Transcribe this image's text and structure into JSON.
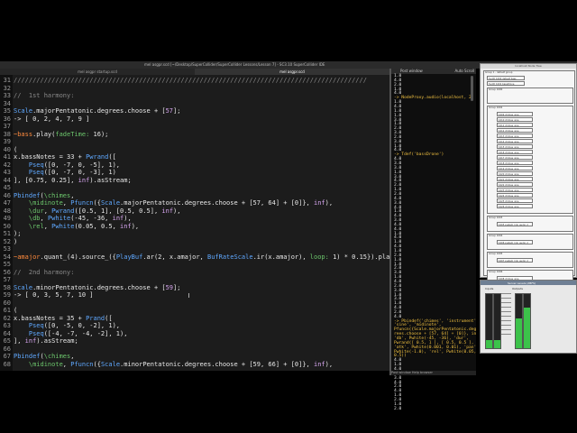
{
  "window": {
    "title": "mel asgpr.scd  [~/Desktop/SuperCollider/SuperCollider Lessons/Lesson 7] - SC3.10  SuperCollider IDE",
    "traffic": [
      "#ff5f56",
      "#ffbd2e",
      "#27c93f"
    ]
  },
  "tabs": [
    {
      "label": "mel asgpr startup.scd"
    },
    {
      "label": "mel asgpr.scd"
    }
  ],
  "editor": {
    "lines": [
      {
        "n": "31",
        "tokens": [
          {
            "c": "t-cmt",
            "t": "/////////////////////////////////////////////////////////////////////////////////////////////"
          }
        ]
      },
      {
        "n": "32",
        "tokens": []
      },
      {
        "n": "33",
        "tokens": [
          {
            "c": "t-cmt",
            "t": "//  1st harmony:"
          }
        ]
      },
      {
        "n": "34",
        "tokens": []
      },
      {
        "n": "35",
        "tokens": [
          {
            "c": "t-cls",
            "t": "Scale"
          },
          {
            "c": "t-def",
            "t": ".majorPentatonic.degrees.choose + ["
          },
          {
            "c": "t-num",
            "t": "57"
          },
          {
            "c": "t-def",
            "t": "];"
          }
        ]
      },
      {
        "n": "36",
        "tokens": [
          {
            "c": "t-def",
            "t": "-> [ 0, 2, 4, 7, 9 ]"
          }
        ]
      },
      {
        "n": "37",
        "tokens": []
      },
      {
        "n": "38",
        "tokens": [
          {
            "c": "t-env",
            "t": "~bass"
          },
          {
            "c": "t-def",
            "t": ".play("
          },
          {
            "c": "t-sym",
            "t": "fadeTime:"
          },
          {
            "c": "t-def",
            "t": " 16);"
          }
        ]
      },
      {
        "n": "39",
        "tokens": []
      },
      {
        "n": "40",
        "tokens": [
          {
            "c": "t-def",
            "t": "("
          }
        ]
      },
      {
        "n": "41",
        "tokens": [
          {
            "c": "t-def",
            "t": "x.bassNotes = 33 + "
          },
          {
            "c": "t-cls",
            "t": "Pwrand"
          },
          {
            "c": "t-def",
            "t": "(["
          }
        ]
      },
      {
        "n": "42",
        "tokens": [
          {
            "c": "t-def",
            "t": "    "
          },
          {
            "c": "t-cls",
            "t": "Pseq"
          },
          {
            "c": "t-def",
            "t": "([0, -7, 0, -5], 1),"
          }
        ]
      },
      {
        "n": "43",
        "tokens": [
          {
            "c": "t-def",
            "t": "    "
          },
          {
            "c": "t-cls",
            "t": "Pseq"
          },
          {
            "c": "t-def",
            "t": "([0, -7, 0, -3], 1)"
          }
        ]
      },
      {
        "n": "44",
        "tokens": [
          {
            "c": "t-def",
            "t": "], [0.75, 0.25], "
          },
          {
            "c": "t-num",
            "t": "inf"
          },
          {
            "c": "t-def",
            "t": ").asStream;"
          }
        ]
      },
      {
        "n": "45",
        "tokens": []
      },
      {
        "n": "46",
        "tokens": [
          {
            "c": "t-cls",
            "t": "Pbindef"
          },
          {
            "c": "t-def",
            "t": "("
          },
          {
            "c": "t-sym",
            "t": "\\chimes"
          },
          {
            "c": "t-def",
            "t": ","
          }
        ]
      },
      {
        "n": "47",
        "tokens": [
          {
            "c": "t-def",
            "t": "    "
          },
          {
            "c": "t-sym",
            "t": "\\midinote"
          },
          {
            "c": "t-def",
            "t": ", "
          },
          {
            "c": "t-cls",
            "t": "Pfuncn"
          },
          {
            "c": "t-def",
            "t": "({"
          },
          {
            "c": "t-cls",
            "t": "Scale"
          },
          {
            "c": "t-def",
            "t": ".majorPentatonic.degrees.choose + [57, 64] + [0]}, "
          },
          {
            "c": "t-num",
            "t": "inf"
          },
          {
            "c": "t-def",
            "t": "),"
          }
        ]
      },
      {
        "n": "48",
        "tokens": [
          {
            "c": "t-def",
            "t": "    "
          },
          {
            "c": "t-sym",
            "t": "\\dur"
          },
          {
            "c": "t-def",
            "t": ", "
          },
          {
            "c": "t-cls",
            "t": "Pwrand"
          },
          {
            "c": "t-def",
            "t": "([0.5, 1], [0.5, 0.5], "
          },
          {
            "c": "t-num",
            "t": "inf"
          },
          {
            "c": "t-def",
            "t": "),"
          }
        ]
      },
      {
        "n": "49",
        "tokens": [
          {
            "c": "t-def",
            "t": "    "
          },
          {
            "c": "t-sym",
            "t": "\\db"
          },
          {
            "c": "t-def",
            "t": ", "
          },
          {
            "c": "t-cls",
            "t": "Pwhite"
          },
          {
            "c": "t-def",
            "t": "(-45, -36, "
          },
          {
            "c": "t-num",
            "t": "inf"
          },
          {
            "c": "t-def",
            "t": "),"
          }
        ]
      },
      {
        "n": "50",
        "tokens": [
          {
            "c": "t-def",
            "t": "    "
          },
          {
            "c": "t-sym",
            "t": "\\rel"
          },
          {
            "c": "t-def",
            "t": ", "
          },
          {
            "c": "t-cls",
            "t": "Pwhite"
          },
          {
            "c": "t-def",
            "t": "(0.05, 0.5, "
          },
          {
            "c": "t-num",
            "t": "inf"
          },
          {
            "c": "t-def",
            "t": "),"
          }
        ]
      },
      {
        "n": "51",
        "tokens": [
          {
            "c": "t-def",
            "t": ");"
          }
        ]
      },
      {
        "n": "52",
        "tokens": [
          {
            "c": "t-def",
            "t": ")"
          }
        ]
      },
      {
        "n": "53",
        "tokens": []
      },
      {
        "n": "54",
        "tokens": [
          {
            "c": "t-env",
            "t": "~amajor"
          },
          {
            "c": "t-def",
            "t": ".quant_(4).source_({"
          },
          {
            "c": "t-cls",
            "t": "PlayBuf"
          },
          {
            "c": "t-def",
            "t": ".ar(2, x.amajor, "
          },
          {
            "c": "t-cls",
            "t": "BufRateScale"
          },
          {
            "c": "t-def",
            "t": ".ir(x.amajor), "
          },
          {
            "c": "t-sym",
            "t": "loop:"
          },
          {
            "c": "t-def",
            "t": " 1) * 0.15}).play("
          },
          {
            "c": "t-sym",
            "t": "fadeTime:"
          },
          {
            "c": "t-def",
            "t": " 16);"
          }
        ]
      },
      {
        "n": "55",
        "tokens": []
      },
      {
        "n": "56",
        "tokens": [
          {
            "c": "t-cmt",
            "t": "//  2nd harmony:"
          }
        ]
      },
      {
        "n": "57",
        "tokens": []
      },
      {
        "n": "58",
        "tokens": [
          {
            "c": "t-cls",
            "t": "Scale"
          },
          {
            "c": "t-def",
            "t": ".minorPentatonic.degrees.choose + ["
          },
          {
            "c": "t-num",
            "t": "59"
          },
          {
            "c": "t-def",
            "t": "];"
          }
        ]
      },
      {
        "n": "59",
        "tokens": [
          {
            "c": "t-def",
            "t": "-> [ 0, 3, 5, 7, 10 ]"
          }
        ]
      },
      {
        "n": "60",
        "tokens": []
      },
      {
        "n": "61",
        "tokens": [
          {
            "c": "t-def",
            "t": "("
          }
        ]
      },
      {
        "n": "62",
        "tokens": [
          {
            "c": "t-def",
            "t": "x.bassNotes = 35 + "
          },
          {
            "c": "t-cls",
            "t": "Prand"
          },
          {
            "c": "t-def",
            "t": "(["
          }
        ]
      },
      {
        "n": "63",
        "tokens": [
          {
            "c": "t-def",
            "t": "    "
          },
          {
            "c": "t-cls",
            "t": "Pseq"
          },
          {
            "c": "t-def",
            "t": "([0, -5, 0, -2], 1),"
          }
        ]
      },
      {
        "n": "64",
        "tokens": [
          {
            "c": "t-def",
            "t": "    "
          },
          {
            "c": "t-cls",
            "t": "Pseq"
          },
          {
            "c": "t-def",
            "t": "([-4, -7, -4, -2], 1),"
          }
        ]
      },
      {
        "n": "65",
        "tokens": [
          {
            "c": "t-def",
            "t": "], "
          },
          {
            "c": "t-num",
            "t": "inf"
          },
          {
            "c": "t-def",
            "t": ").asStream;"
          }
        ]
      },
      {
        "n": "66",
        "tokens": []
      },
      {
        "n": "67",
        "tokens": [
          {
            "c": "t-cls",
            "t": "Pbindef"
          },
          {
            "c": "t-def",
            "t": "("
          },
          {
            "c": "t-sym",
            "t": "\\chimes"
          },
          {
            "c": "t-def",
            "t": ","
          }
        ]
      },
      {
        "n": "68",
        "tokens": [
          {
            "c": "t-def",
            "t": "    "
          },
          {
            "c": "t-sym",
            "t": "\\midinote"
          },
          {
            "c": "t-def",
            "t": ", "
          },
          {
            "c": "t-cls",
            "t": "Pfuncn"
          },
          {
            "c": "t-def",
            "t": "({"
          },
          {
            "c": "t-cls",
            "t": "Scale"
          },
          {
            "c": "t-def",
            "t": ".minorPentatonic.degrees.choose + [59, 66] + [0]}, "
          },
          {
            "c": "t-num",
            "t": "inf"
          },
          {
            "c": "t-def",
            "t": "),"
          }
        ]
      }
    ]
  },
  "post": {
    "title": "Post window",
    "right_label": "Auto Scroll",
    "footer": "Post window   Help browser",
    "lines": [
      "1.0",
      "4.0",
      "2.0",
      "1.0",
      "4.0",
      "-> NodeProxy.audio(localhost, 2)",
      "1.0",
      "4.0",
      "1.0",
      "1.0",
      "3.0",
      "1.0",
      "2.0",
      "3.0",
      "2.0",
      "3.0",
      "1.0",
      "4.0",
      "-> Tdef('bassDrone')",
      "4.0",
      "3.0",
      "3.0",
      "1.0",
      "3.0",
      "4.0",
      "2.0",
      "1.0",
      "2.0",
      "4.0",
      "3.0",
      "4.0",
      "1.0",
      "4.0",
      "3.0",
      "4.0",
      "4.0",
      "1.0",
      "4.0",
      "1.0",
      "4.0",
      "1.0",
      "2.0",
      "1.0",
      "1.0",
      "2.0",
      "3.0",
      "1.0",
      "4.0",
      "2.0",
      "3.0",
      "1.0",
      "3.0",
      "1.0",
      "4.0",
      "2.0",
      "4.0",
      "-> Pbindef('chimes', 'instrument',",
      "'sine', 'midinote',",
      "Pfuncn({Scale.majorPentatonic.deg",
      "rees.choose + [57, 64] + [0]}, inf),",
      "'db', Pwhite(-45, -36), 'dur',",
      "Pwrand([ 0.5, 1 ], [ 0.5, 0.5 ], inf),",
      "'atk', Pwhite(0.001, 0.01), 'pan',",
      "Pwhite(-1.0), 'rel', Pwhite(0.05,",
      "0.5))",
      "4.0",
      "1.0",
      "4.0",
      "2.0",
      "3.0",
      "4.0",
      "2.0",
      "4.0",
      "1.0",
      "2.0",
      "1.0",
      "2.0"
    ]
  },
  "tree": {
    "title": "localhost Node Tree",
    "top_group": "Group 1 - default group",
    "top_items": [
      "Synth 1000 default  bass",
      "Synth 1001 bassDrone"
    ],
    "groups": [
      {
        "label": "Group 1000",
        "items": []
      },
      {
        "label": "Group 1002",
        "items": [
          "1009 chimes_sine",
          "1010 chimes_sine",
          "1011 chimes_sine",
          "1012 chimes_sine",
          "1013 chimes_sine",
          "1014 chimes_sine",
          "1015 chimes_sine",
          "1016 chimes_sine",
          "1017 chimes_sine",
          "1018 chimes_sine",
          "1019 chimes_sine",
          "1020 chimes_sine",
          "1021 chimes_sine",
          "1022 chimes_sine",
          "1023 chimes_sine",
          "1024 chimes_sine",
          "1025 chimes_sine",
          "1026 chimes_sine"
        ]
      },
      {
        "label": "Group 1003",
        "items": [
          "1005 system_link_audio_2"
        ]
      },
      {
        "label": "Group 1004",
        "items": [
          "1006 system_link_audio_2"
        ]
      },
      {
        "label": "Group 1005",
        "items": [
          "1007 system_link_audio_2"
        ]
      },
      {
        "label": "Group 1006",
        "items": [
          "1008 chimes_sine"
        ]
      }
    ]
  },
  "meters": {
    "title": "Server Levels (dBFS)",
    "labels": [
      "Inputs",
      "Outputs"
    ],
    "levels": [
      0.15,
      0.15,
      0.55,
      0.75
    ]
  }
}
